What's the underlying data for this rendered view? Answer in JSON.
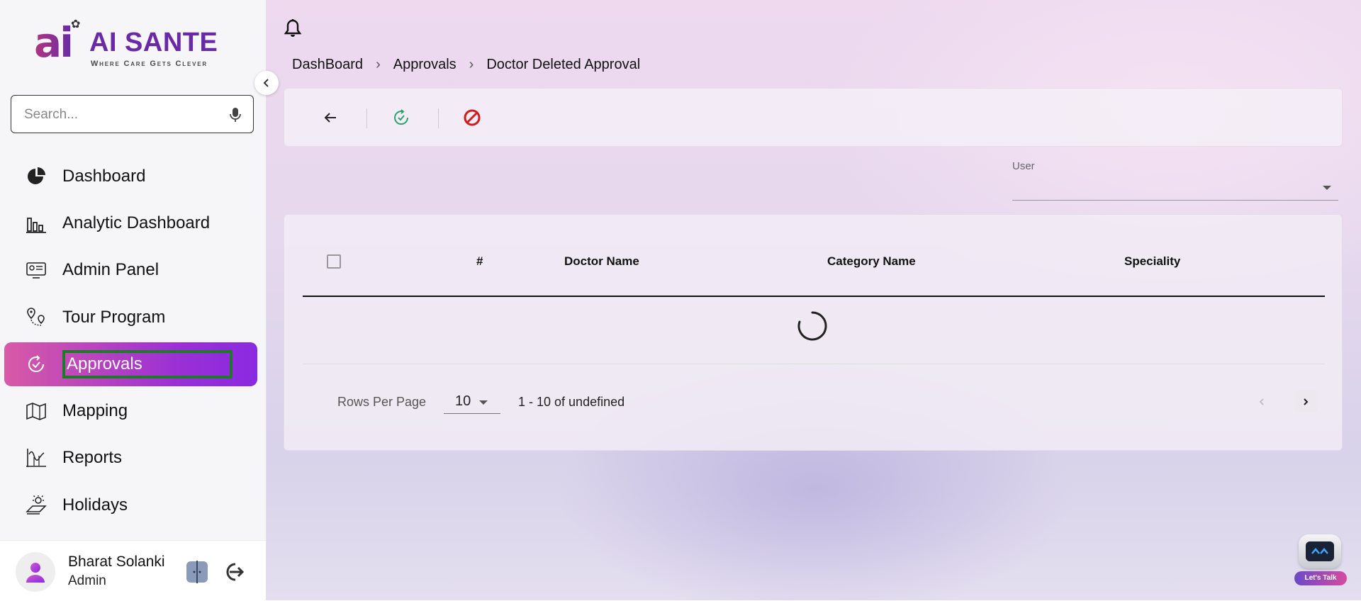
{
  "brand": {
    "logo_mark": "ai",
    "name": "AI SANTE",
    "tagline": "Where Care Gets Clever"
  },
  "search": {
    "placeholder": "Search..."
  },
  "sidebar": {
    "items": [
      {
        "label": "Dashboard",
        "icon": "pie-chart-icon"
      },
      {
        "label": "Analytic Dashboard",
        "icon": "bar-chart-icon"
      },
      {
        "label": "Admin Panel",
        "icon": "admin-panel-icon"
      },
      {
        "label": "Tour Program",
        "icon": "route-icon"
      },
      {
        "label": "Approvals",
        "icon": "approval-icon",
        "active": true
      },
      {
        "label": "Mapping",
        "icon": "map-icon"
      },
      {
        "label": "Reports",
        "icon": "reports-icon"
      },
      {
        "label": "Holidays",
        "icon": "holiday-icon"
      }
    ]
  },
  "user": {
    "name": "Bharat Solanki",
    "role": "Admin"
  },
  "breadcrumb": [
    "DashBoard",
    "Approvals",
    "Doctor Deleted Approval"
  ],
  "filter": {
    "user_label": "User",
    "user_value": ""
  },
  "table": {
    "columns": [
      "#",
      "Doctor Name",
      "Category Name",
      "Speciality"
    ],
    "rows": []
  },
  "pagination": {
    "rows_per_page_label": "Rows Per Page",
    "rows_per_page": "10",
    "range": "1 - 10 of undefined"
  },
  "chatbot": {
    "label": "Let's Talk"
  },
  "colors": {
    "accent_start": "#d85aa6",
    "accent_end": "#8a2ae0",
    "approve_green": "#2aa56a",
    "reject_red": "#d01c1c"
  }
}
